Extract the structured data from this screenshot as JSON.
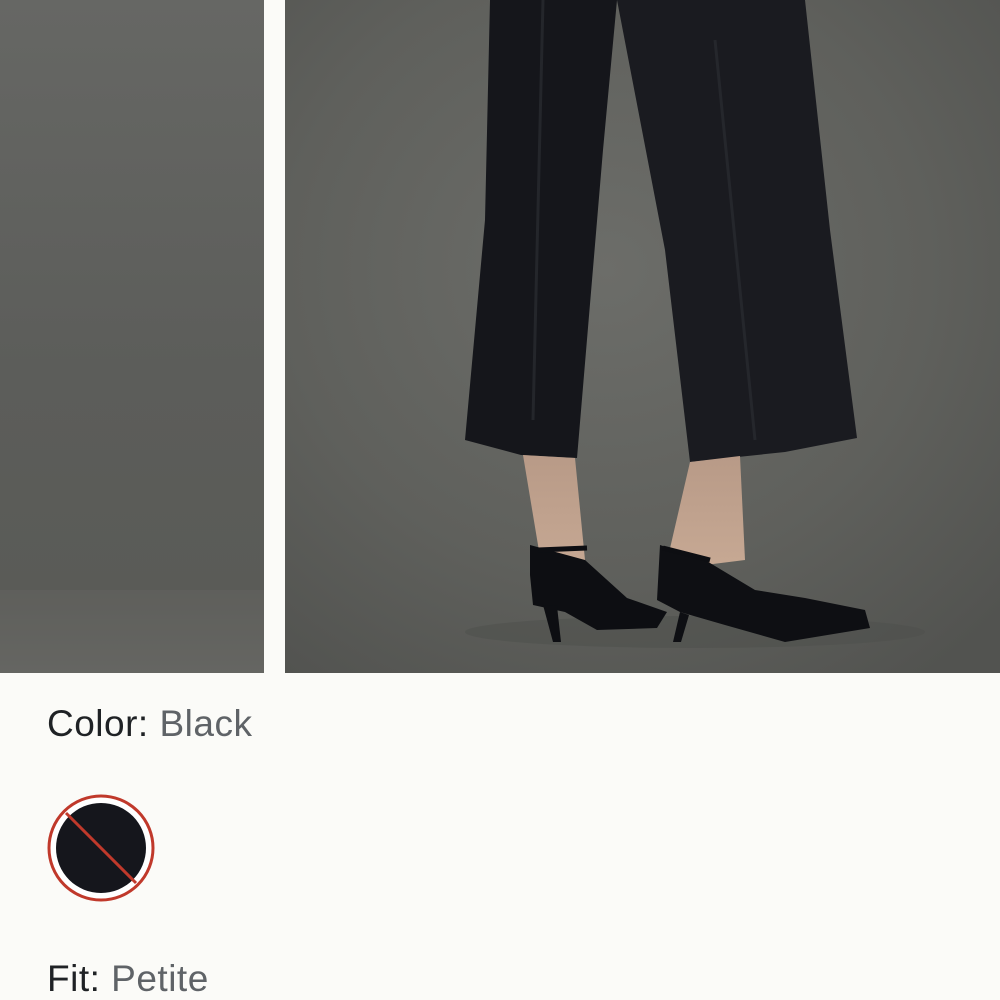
{
  "gallery": {
    "images": [
      {
        "name": "product-image-side"
      },
      {
        "name": "product-image-main",
        "alt": ""
      }
    ]
  },
  "color": {
    "label": "Color:",
    "value": "Black",
    "swatch": {
      "name": "Black",
      "fill": "#15161c",
      "ring": "#c0392b",
      "state": "unavailable"
    }
  },
  "fit": {
    "label": "Fit:",
    "value": "Petite"
  }
}
